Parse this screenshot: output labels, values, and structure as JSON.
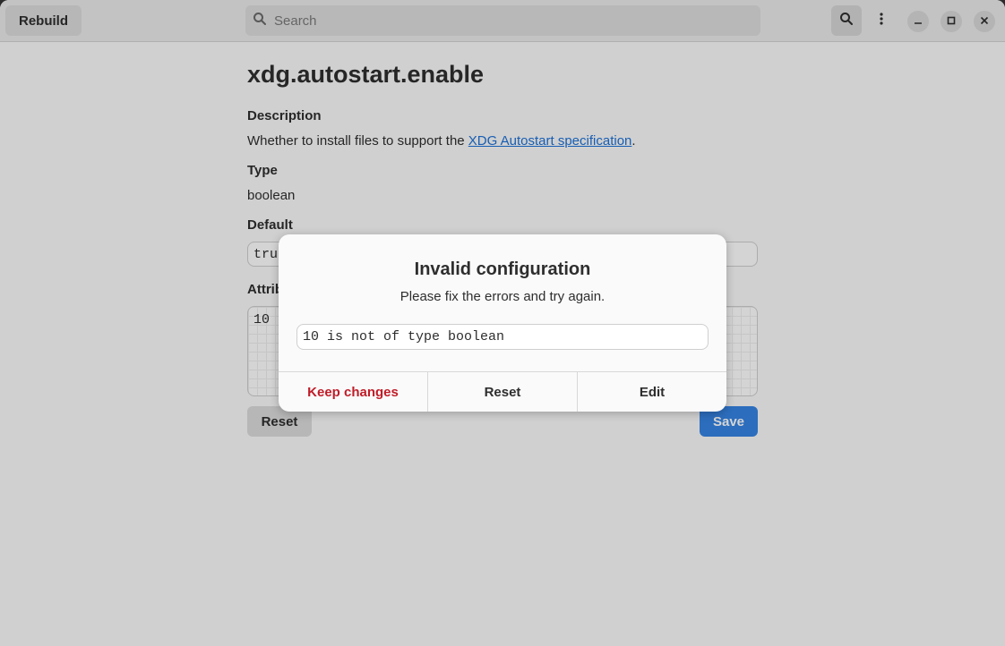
{
  "header": {
    "rebuild_label": "Rebuild",
    "search_placeholder": "Search"
  },
  "option": {
    "name": "xdg.autostart.enable",
    "description_label": "Description",
    "description_prefix": "Whether to install files to support the ",
    "description_link": "XDG Autostart specification",
    "description_suffix": ".",
    "type_label": "Type",
    "type_value": "boolean",
    "default_label": "Default",
    "default_value": "true",
    "attribute_label": "Attribute",
    "attribute_value": "10",
    "reset_label": "Reset",
    "save_label": "Save"
  },
  "dialog": {
    "title": "Invalid configuration",
    "body": "Please fix the errors and try again.",
    "error_text": "10 is not of type boolean",
    "keep_label": "Keep changes",
    "reset_label": "Reset",
    "edit_label": "Edit"
  },
  "colors": {
    "accent": "#3584e4",
    "destructive": "#c01c28",
    "link": "#1c71d8"
  },
  "icons": [
    "search-icon",
    "search-toggle-icon",
    "menu-icon",
    "minimize-icon",
    "maximize-icon",
    "close-icon"
  ]
}
